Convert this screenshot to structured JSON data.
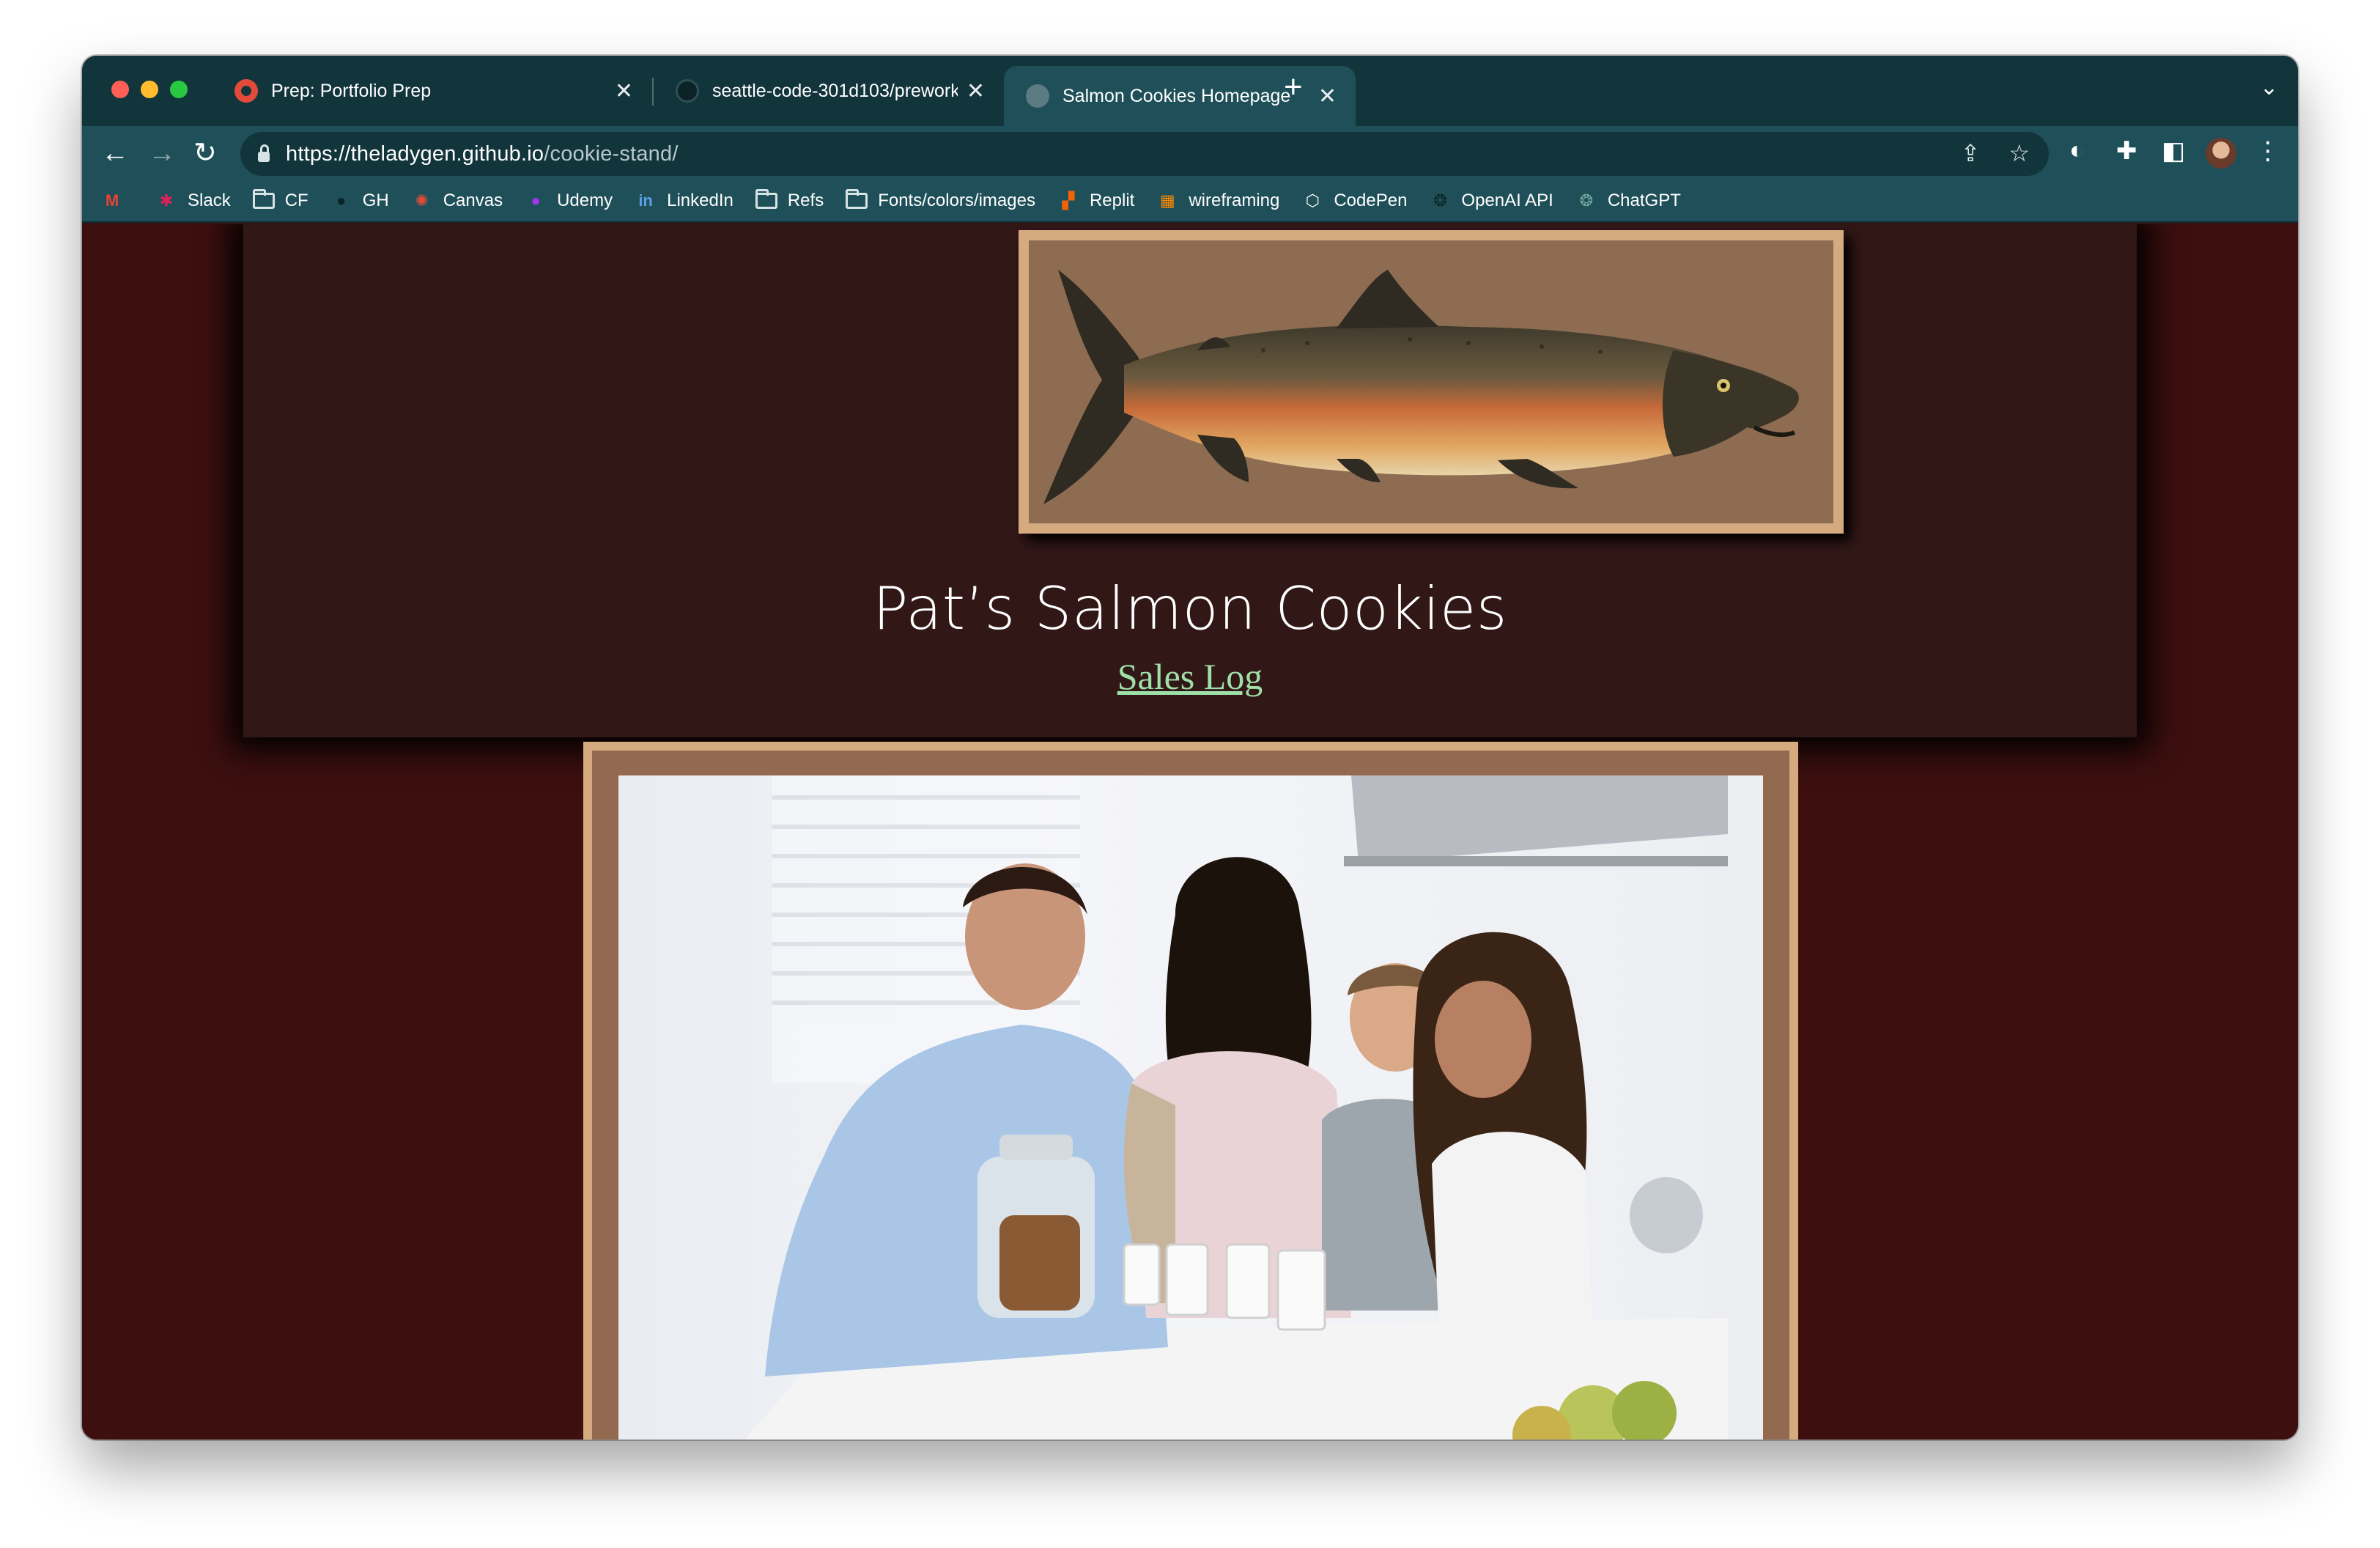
{
  "browser": {
    "tabs": [
      {
        "title": "Prep: Portfolio Prep",
        "close": "✕",
        "active": false
      },
      {
        "title": "seattle-code-301d103/prework",
        "close": "✕",
        "active": false
      },
      {
        "title": "Salmon Cookies Homepage",
        "close": "✕",
        "active": true
      }
    ],
    "new_tab_glyph": "+",
    "tab_menu_glyph": "⌄",
    "nav": {
      "back": "←",
      "forward": "→",
      "reload": "↻"
    },
    "url_host": "https://theladygen.github.io",
    "url_path": "/cookie-stand/",
    "icons": [
      "share-icon",
      "star-icon",
      "extension-icon",
      "puzzle-icon",
      "sidepanel-icon",
      "avatar",
      "menu-icon"
    ]
  },
  "bookmarks": [
    {
      "label": "",
      "icon": "gmail-icon"
    },
    {
      "label": "Slack",
      "icon": "slack-icon"
    },
    {
      "label": "CF",
      "icon": "folder-icon"
    },
    {
      "label": "GH",
      "icon": "github-icon"
    },
    {
      "label": "Canvas",
      "icon": "canvas-icon"
    },
    {
      "label": "Udemy",
      "icon": "udemy-icon"
    },
    {
      "label": "LinkedIn",
      "icon": "linkedin-icon"
    },
    {
      "label": "Refs",
      "icon": "folder-icon"
    },
    {
      "label": "Fonts/colors/images",
      "icon": "folder-icon"
    },
    {
      "label": "Replit",
      "icon": "replit-icon"
    },
    {
      "label": "wireframing",
      "icon": "wireframing-icon"
    },
    {
      "label": "CodePen",
      "icon": "codepen-icon"
    },
    {
      "label": "OpenAI API",
      "icon": "openai-icon"
    },
    {
      "label": "ChatGPT",
      "icon": "chatgpt-icon"
    }
  ],
  "page": {
    "title": "Pat’s Salmon Cookies",
    "nav_link": "Sales Log",
    "colors": {
      "background": "#3d0f0f",
      "header": "#321717",
      "frame": "#d4aa7e",
      "mat": "#936a4f",
      "link": "#9ee0a8"
    }
  }
}
